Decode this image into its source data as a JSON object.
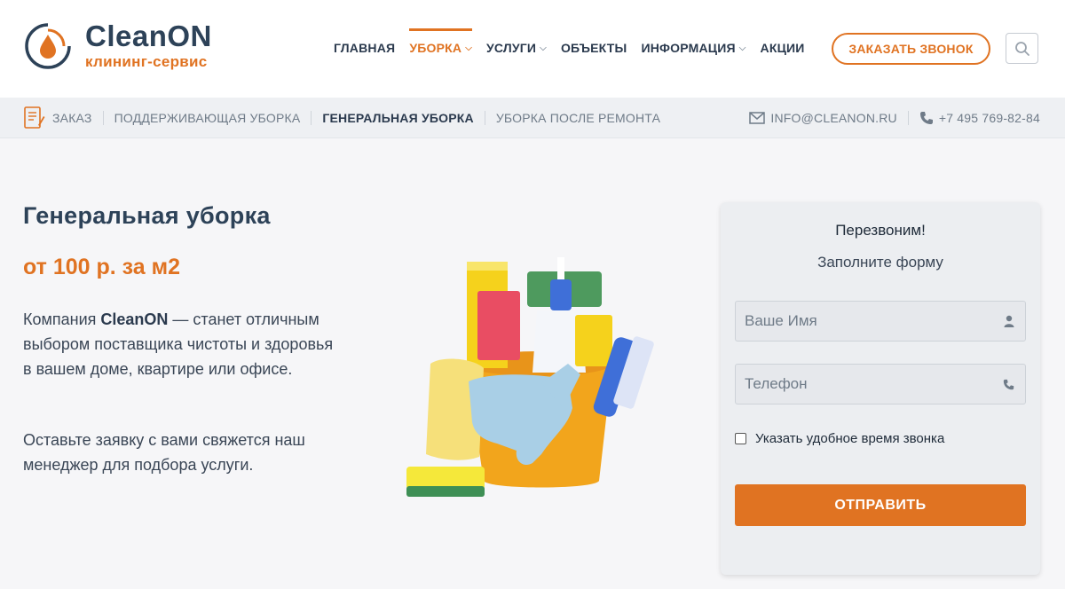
{
  "brand": {
    "name": "CleanON",
    "tagline": "клининг-сервис",
    "accent_color": "#e07322",
    "dark_color": "#2d4258"
  },
  "nav": {
    "items": [
      {
        "label": "ГЛАВНАЯ",
        "dropdown": false,
        "active": false
      },
      {
        "label": "УБОРКА",
        "dropdown": true,
        "active": true
      },
      {
        "label": "УСЛУГИ",
        "dropdown": true,
        "active": false
      },
      {
        "label": "ОБЪЕКТЫ",
        "dropdown": false,
        "active": false
      },
      {
        "label": "ИНФОРМАЦИЯ",
        "dropdown": true,
        "active": false
      },
      {
        "label": "АКЦИИ",
        "dropdown": false,
        "active": false
      }
    ],
    "call_button": "ЗАКАЗАТЬ ЗВОНОК",
    "search_icon": "search-icon"
  },
  "subnav": {
    "order": "ЗАКАЗ",
    "items": [
      {
        "label": "ПОДДЕРЖИВАЮЩАЯ УБОРКА",
        "current": false
      },
      {
        "label": "ГЕНЕРАЛЬНАЯ УБОРКА",
        "current": true
      },
      {
        "label": "УБОРКА ПОСЛЕ РЕМОНТА",
        "current": false
      }
    ],
    "email": "INFO@CLEANON.RU",
    "phone": "+7 495 769-82-84"
  },
  "hero": {
    "title": "Генеральная уборка",
    "price": "от 100 р. за м2",
    "text_prefix": "Компания ",
    "text_brand": "CleanON",
    "text_suffix": " — станет отличным выбором поставщика чистоты и здоровья в вашем доме, квартире или офисе.",
    "text2": "Оставьте заявку с вами свяжется наш менеджер для подбора услуги."
  },
  "form": {
    "title": "Перезвоним!",
    "subtitle": "Заполните форму",
    "name_placeholder": "Ваше Имя",
    "phone_placeholder": "Телефон",
    "checkbox_label": "Указать удобное время звонка",
    "submit": "ОТПРАВИТЬ"
  }
}
